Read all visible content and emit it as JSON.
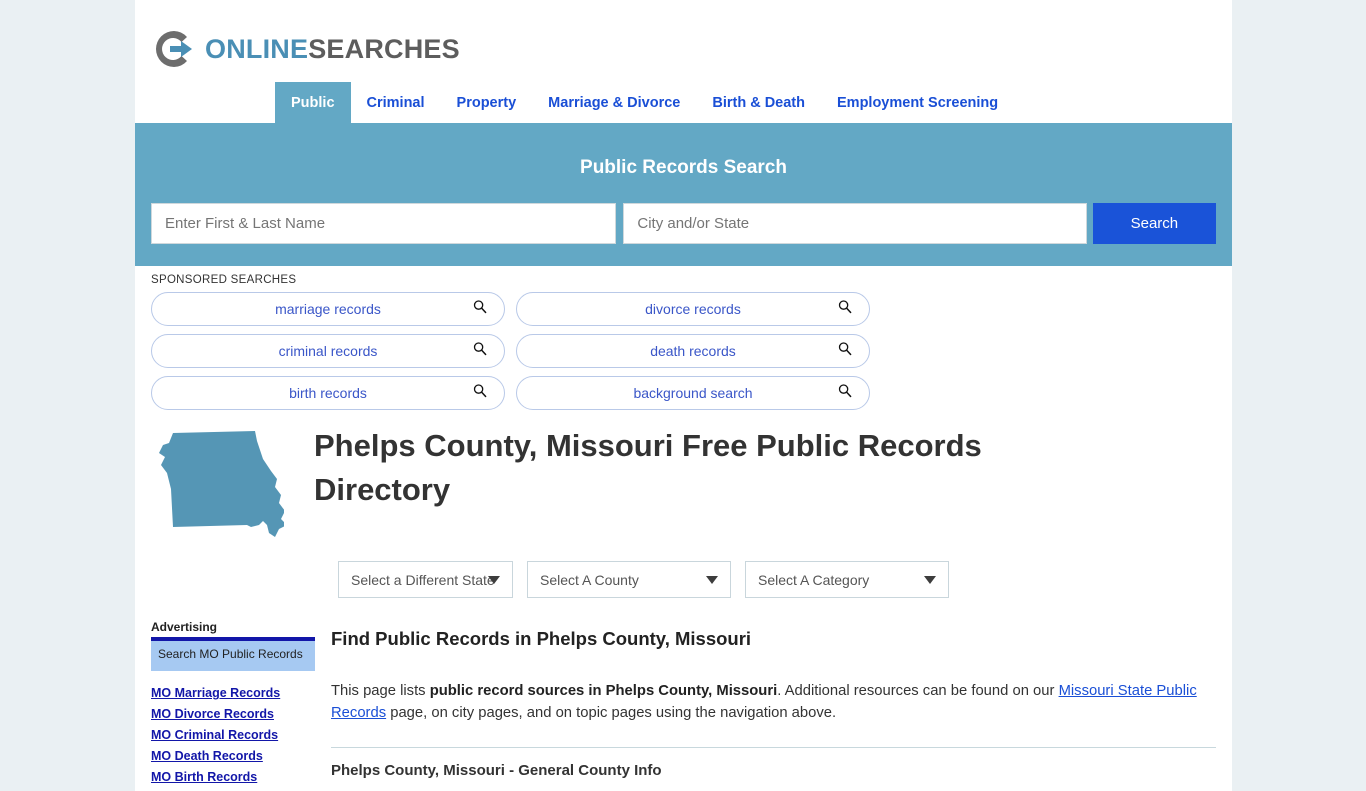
{
  "brand": {
    "name_part1": "ONLINE",
    "name_part2": "SEARCHES",
    "logo_icon": "circle-arrow-logo-icon"
  },
  "nav": {
    "items": [
      {
        "label": "Public",
        "active": true
      },
      {
        "label": "Criminal",
        "active": false
      },
      {
        "label": "Property",
        "active": false
      },
      {
        "label": "Marriage & Divorce",
        "active": false
      },
      {
        "label": "Birth & Death",
        "active": false
      },
      {
        "label": "Employment Screening",
        "active": false
      }
    ]
  },
  "banner": {
    "title": "Public Records Search",
    "name_placeholder": "Enter First & Last Name",
    "name_value": "",
    "place_placeholder": "City and/or State",
    "place_value": "",
    "search_button": "Search",
    "bg_color": "#63a8c5",
    "button_color": "#1a53d8"
  },
  "sponsored": {
    "label": "SPONSORED SEARCHES",
    "pills": [
      {
        "label": "marriage records",
        "icon": "search-icon"
      },
      {
        "label": "divorce records",
        "icon": "search-icon"
      },
      {
        "label": "criminal records",
        "icon": "search-icon"
      },
      {
        "label": "death records",
        "icon": "search-icon"
      },
      {
        "label": "birth records",
        "icon": "search-icon"
      },
      {
        "label": "background search",
        "icon": "search-icon"
      }
    ]
  },
  "hero": {
    "title": "Phelps County, Missouri Free Public Records Directory",
    "map_icon": "missouri-state-map-icon",
    "map_color": "#5596b5"
  },
  "selects": [
    {
      "label": "Select a Different State",
      "name": "state"
    },
    {
      "label": "Select A County",
      "name": "county"
    },
    {
      "label": "Select A Category",
      "name": "category"
    }
  ],
  "sidebar": {
    "advertising_label": "Advertising",
    "ad_text": "Search MO Public Records",
    "links": [
      "MO Marriage Records",
      "MO Divorce Records",
      "MO Criminal Records",
      "MO Death Records",
      "MO Birth Records"
    ]
  },
  "main": {
    "heading": "Find Public Records in Phelps County, Missouri",
    "intro_1": "This page lists ",
    "intro_bold": "public record sources in Phelps County, Missouri",
    "intro_2": ". Additional resources can be found on our ",
    "intro_link": "Missouri State Public Records",
    "intro_3": " page, on city pages, and on topic pages using the navigation above.",
    "subsection": "Phelps County, Missouri - General County Info"
  }
}
